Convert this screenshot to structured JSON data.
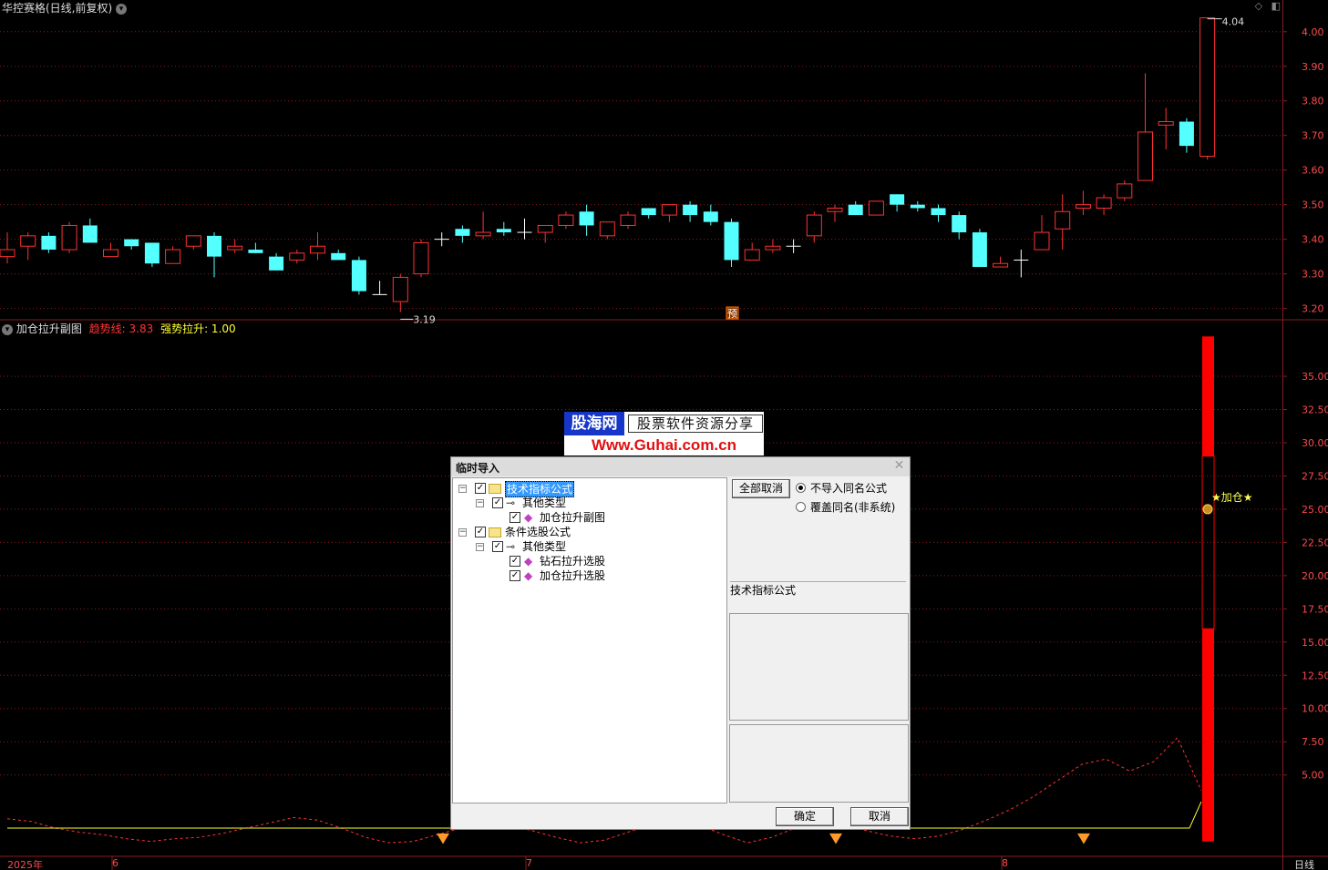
{
  "chart_header": {
    "stock_title": "华控赛格(日线,前复权)",
    "title_icon": "chevron-down-icon"
  },
  "right_toolbar": {
    "icons": [
      "diamond-icon",
      "panel-toggle-icon"
    ],
    "diamond": "◇",
    "toggle": "◧"
  },
  "sub_header": {
    "indicator_name": "加仓拉升副图",
    "trend_label": "趋势线: 3.83",
    "surge_label": "强势拉升: 1.00"
  },
  "colors": {
    "up": "#ff3232",
    "down": "#54ffff",
    "grid": "#8a1c1c",
    "axis_text": "#ff4a4a",
    "trend_line": "#ff3333",
    "surge_line": "#ffff33",
    "bar": "#ff0000"
  },
  "labels": {
    "high_marker": "4.04",
    "low_marker": "3.19",
    "yu_badge": "预",
    "add_position_signal": "★加仓★",
    "bottom_right": "日线"
  },
  "chart_data": [
    {
      "type": "candlestick",
      "title": "华控赛格(日线,前复权)",
      "y_ticks": [
        "4.00",
        "3.90",
        "3.80",
        "3.70",
        "3.60",
        "3.50",
        "3.40",
        "3.30",
        "3.20"
      ],
      "ylim": [
        3.17,
        4.06
      ],
      "grid": true,
      "candles": [
        {
          "o": 3.35,
          "c": 3.37,
          "h": 3.42,
          "l": 3.33
        },
        {
          "o": 3.38,
          "c": 3.41,
          "h": 3.42,
          "l": 3.34
        },
        {
          "o": 3.41,
          "c": 3.37,
          "h": 3.42,
          "l": 3.36
        },
        {
          "o": 3.37,
          "c": 3.44,
          "h": 3.45,
          "l": 3.36
        },
        {
          "o": 3.44,
          "c": 3.39,
          "h": 3.46,
          "l": 3.39
        },
        {
          "o": 3.35,
          "c": 3.37,
          "h": 3.39,
          "l": 3.35
        },
        {
          "o": 3.4,
          "c": 3.38,
          "h": 3.4,
          "l": 3.37
        },
        {
          "o": 3.39,
          "c": 3.33,
          "h": 3.39,
          "l": 3.32
        },
        {
          "o": 3.33,
          "c": 3.37,
          "h": 3.38,
          "l": 3.33
        },
        {
          "o": 3.38,
          "c": 3.41,
          "h": 3.41,
          "l": 3.37
        },
        {
          "o": 3.41,
          "c": 3.35,
          "h": 3.42,
          "l": 3.29
        },
        {
          "o": 3.37,
          "c": 3.38,
          "h": 3.4,
          "l": 3.36
        },
        {
          "o": 3.37,
          "c": 3.36,
          "h": 3.39,
          "l": 3.36
        },
        {
          "o": 3.35,
          "c": 3.31,
          "h": 3.36,
          "l": 3.31
        },
        {
          "o": 3.34,
          "c": 3.36,
          "h": 3.37,
          "l": 3.33
        },
        {
          "o": 3.36,
          "c": 3.38,
          "h": 3.42,
          "l": 3.34
        },
        {
          "o": 3.36,
          "c": 3.34,
          "h": 3.37,
          "l": 3.34
        },
        {
          "o": 3.34,
          "c": 3.25,
          "h": 3.35,
          "l": 3.24
        },
        {
          "o": 3.24,
          "c": 3.24,
          "h": 3.28,
          "l": 3.24
        },
        {
          "o": 3.22,
          "c": 3.29,
          "h": 3.3,
          "l": 3.19
        },
        {
          "o": 3.3,
          "c": 3.39,
          "h": 3.4,
          "l": 3.29
        },
        {
          "o": 3.4,
          "c": 3.4,
          "h": 3.42,
          "l": 3.38
        },
        {
          "o": 3.43,
          "c": 3.41,
          "h": 3.44,
          "l": 3.39
        },
        {
          "o": 3.41,
          "c": 3.42,
          "h": 3.48,
          "l": 3.4
        },
        {
          "o": 3.43,
          "c": 3.42,
          "h": 3.45,
          "l": 3.41
        },
        {
          "o": 3.42,
          "c": 3.42,
          "h": 3.46,
          "l": 3.4
        },
        {
          "o": 3.42,
          "c": 3.44,
          "h": 3.44,
          "l": 3.39
        },
        {
          "o": 3.44,
          "c": 3.47,
          "h": 3.48,
          "l": 3.43
        },
        {
          "o": 3.48,
          "c": 3.44,
          "h": 3.5,
          "l": 3.41
        },
        {
          "o": 3.41,
          "c": 3.45,
          "h": 3.45,
          "l": 3.4
        },
        {
          "o": 3.44,
          "c": 3.47,
          "h": 3.48,
          "l": 3.43
        },
        {
          "o": 3.49,
          "c": 3.47,
          "h": 3.49,
          "l": 3.46
        },
        {
          "o": 3.47,
          "c": 3.5,
          "h": 3.5,
          "l": 3.45
        },
        {
          "o": 3.5,
          "c": 3.47,
          "h": 3.51,
          "l": 3.45
        },
        {
          "o": 3.48,
          "c": 3.45,
          "h": 3.5,
          "l": 3.44
        },
        {
          "o": 3.45,
          "c": 3.34,
          "h": 3.46,
          "l": 3.32
        },
        {
          "o": 3.34,
          "c": 3.37,
          "h": 3.39,
          "l": 3.34
        },
        {
          "o": 3.37,
          "c": 3.38,
          "h": 3.4,
          "l": 3.36
        },
        {
          "o": 3.38,
          "c": 3.38,
          "h": 3.4,
          "l": 3.36
        },
        {
          "o": 3.41,
          "c": 3.47,
          "h": 3.48,
          "l": 3.39
        },
        {
          "o": 3.48,
          "c": 3.49,
          "h": 3.5,
          "l": 3.45
        },
        {
          "o": 3.5,
          "c": 3.47,
          "h": 3.51,
          "l": 3.47
        },
        {
          "o": 3.47,
          "c": 3.51,
          "h": 3.51,
          "l": 3.47
        },
        {
          "o": 3.53,
          "c": 3.5,
          "h": 3.53,
          "l": 3.48
        },
        {
          "o": 3.5,
          "c": 3.49,
          "h": 3.51,
          "l": 3.48
        },
        {
          "o": 3.49,
          "c": 3.47,
          "h": 3.5,
          "l": 3.45
        },
        {
          "o": 3.47,
          "c": 3.42,
          "h": 3.48,
          "l": 3.4
        },
        {
          "o": 3.42,
          "c": 3.32,
          "h": 3.43,
          "l": 3.32
        },
        {
          "o": 3.32,
          "c": 3.33,
          "h": 3.35,
          "l": 3.32
        },
        {
          "o": 3.34,
          "c": 3.34,
          "h": 3.37,
          "l": 3.29
        },
        {
          "o": 3.37,
          "c": 3.42,
          "h": 3.47,
          "l": 3.37
        },
        {
          "o": 3.43,
          "c": 3.48,
          "h": 3.53,
          "l": 3.37
        },
        {
          "o": 3.49,
          "c": 3.5,
          "h": 3.54,
          "l": 3.47
        },
        {
          "o": 3.49,
          "c": 3.52,
          "h": 3.53,
          "l": 3.47
        },
        {
          "o": 3.52,
          "c": 3.56,
          "h": 3.57,
          "l": 3.51
        },
        {
          "o": 3.57,
          "c": 3.71,
          "h": 3.88,
          "l": 3.57
        },
        {
          "o": 3.73,
          "c": 3.74,
          "h": 3.78,
          "l": 3.66
        },
        {
          "o": 3.74,
          "c": 3.67,
          "h": 3.75,
          "l": 3.65
        },
        {
          "o": 3.64,
          "c": 4.04,
          "h": 4.04,
          "l": 3.63
        }
      ]
    },
    {
      "type": "line",
      "title": "加仓拉升副图",
      "y_ticks": [
        "35.00",
        "32.50",
        "30.00",
        "27.50",
        "25.00",
        "22.50",
        "20.00",
        "17.50",
        "15.00",
        "12.50",
        "10.00",
        "7.50",
        "5.00"
      ],
      "ylim": [
        -0.3,
        38.5
      ],
      "series": [
        {
          "name": "趋势线",
          "style": "dashed",
          "values": [
            1.7,
            1.5,
            1.0,
            0.7,
            0.5,
            0.2,
            0.0,
            0.2,
            0.3,
            0.6,
            1.0,
            1.4,
            1.8,
            1.6,
            1.0,
            0.3,
            -0.1,
            0.0,
            0.5,
            1.0,
            1.4,
            1.2,
            0.8,
            0.3,
            -0.1,
            0.1,
            0.7,
            1.3,
            1.6,
            1.2,
            0.5,
            -0.1,
            0.3,
            1.0,
            1.5,
            1.3,
            0.8,
            0.4,
            0.2,
            0.4,
            0.9,
            1.6,
            2.4,
            3.4,
            4.6,
            5.8,
            6.2,
            5.3,
            6.0,
            7.8,
            3.83
          ]
        },
        {
          "name": "强势拉升",
          "style": "solid",
          "values": [
            1.0,
            1.0,
            1.0,
            1.0,
            1.0,
            1.0,
            1.0,
            1.0,
            1.0,
            1.0,
            1.0,
            1.0,
            1.0,
            1.0,
            1.0,
            1.0,
            1.0,
            1.0,
            1.0,
            1.0,
            1.0,
            1.0,
            1.0,
            1.0,
            1.0,
            1.0,
            1.0,
            1.0,
            1.0,
            1.0,
            1.0,
            1.0,
            1.0,
            1.0,
            1.0,
            1.0,
            1.0,
            1.0,
            1.0,
            1.0,
            1.0,
            1.0,
            1.0,
            1.0,
            1.0,
            1.0,
            1.0,
            1.0,
            1.0,
            1.0,
            1.0
          ]
        },
        {
          "name": "bar_segments",
          "style": "bar",
          "values": [
            [
              0,
              16
            ],
            [
              29,
              38
            ]
          ]
        }
      ],
      "x_ticks": [
        "2025年",
        "6",
        "7",
        "8"
      ]
    }
  ],
  "banner": {
    "logo": "股海网",
    "slogan": "股票软件资源分享",
    "url": "Www.Guhai.com.cn"
  },
  "dialog": {
    "title": "临时导入",
    "close": "✕",
    "tree": [
      {
        "label": "技术指标公式",
        "level": 0,
        "type": "folder",
        "checked": true,
        "selected": true
      },
      {
        "label": "其他类型",
        "level": 1,
        "type": "key",
        "checked": true
      },
      {
        "label": "加仓拉升副图",
        "level": 2,
        "type": "formula",
        "checked": true
      },
      {
        "label": "条件选股公式",
        "level": 0,
        "type": "folder",
        "checked": true
      },
      {
        "label": "其他类型",
        "level": 1,
        "type": "key",
        "checked": true
      },
      {
        "label": "钻石拉升选股",
        "level": 2,
        "type": "formula",
        "checked": true
      },
      {
        "label": "加仓拉升选股",
        "level": 2,
        "type": "formula",
        "checked": true
      }
    ],
    "deselect_all_button": "全部取消",
    "radio_options": [
      {
        "label": "不导入同名公式",
        "selected": true
      },
      {
        "label": "覆盖同名(非系统)",
        "selected": false
      }
    ],
    "info_label": "技术指标公式",
    "ok_button": "确定",
    "cancel_button": "取消"
  }
}
